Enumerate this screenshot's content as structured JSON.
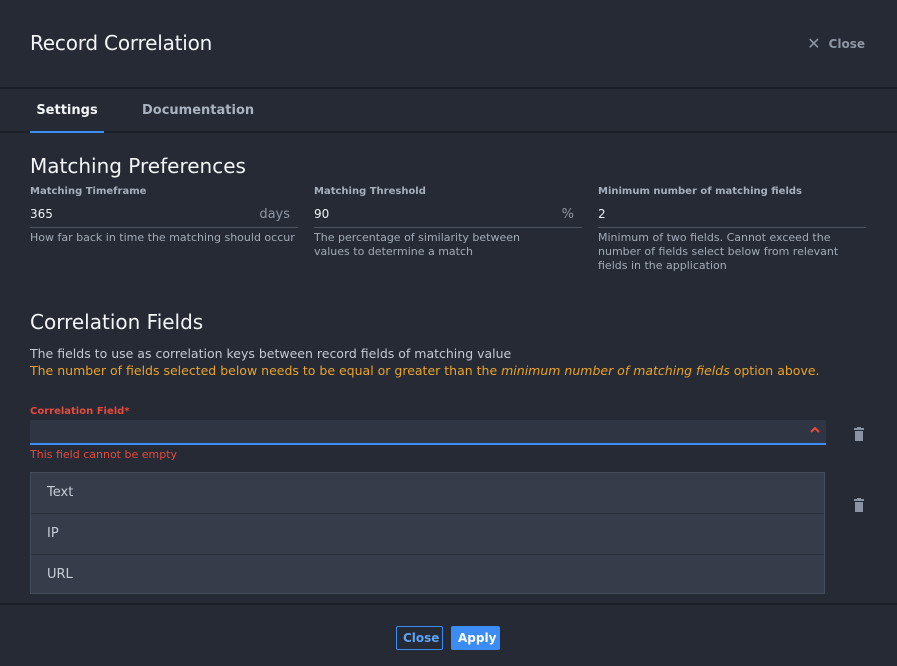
{
  "dialog": {
    "title": "Record Correlation",
    "close_label": "Close"
  },
  "tabs": [
    {
      "label": "Settings",
      "active": true
    },
    {
      "label": "Documentation",
      "active": false
    }
  ],
  "matching_preferences": {
    "title": "Matching Preferences",
    "timeframe": {
      "label": "Matching Timeframe",
      "value": "365",
      "unit": "days",
      "help": "How far back in time the matching should occur"
    },
    "threshold": {
      "label": "Matching Threshold",
      "value": "90",
      "unit": "%",
      "help": "The percentage of similarity between values to determine a match"
    },
    "min_fields": {
      "label": "Minimum number of matching fields",
      "value": "2",
      "help": "Minimum of two fields. Cannot exceed the number of fields select below from relevant fields in the application"
    }
  },
  "correlation_fields": {
    "title": "Correlation Fields",
    "description": "The fields to use as correlation keys between record fields of matching value",
    "warning_pre": "The number of fields selected below needs to be equal or greater than the ",
    "warning_em": "minimum number of matching fields",
    "warning_post": " option above.",
    "field_label": "Correlation Field*",
    "field_value": "",
    "error": "This field cannot be empty",
    "options": [
      "Text",
      "IP",
      "URL"
    ]
  },
  "footer": {
    "close_label": "Close",
    "apply_label": "Apply"
  },
  "colors": {
    "accent": "#3b8cf5",
    "error": "#e54b3d",
    "warning": "#e8a32a",
    "background": "#252a34"
  },
  "icons": [
    "close-icon",
    "chevron-up-icon",
    "trash-icon"
  ]
}
